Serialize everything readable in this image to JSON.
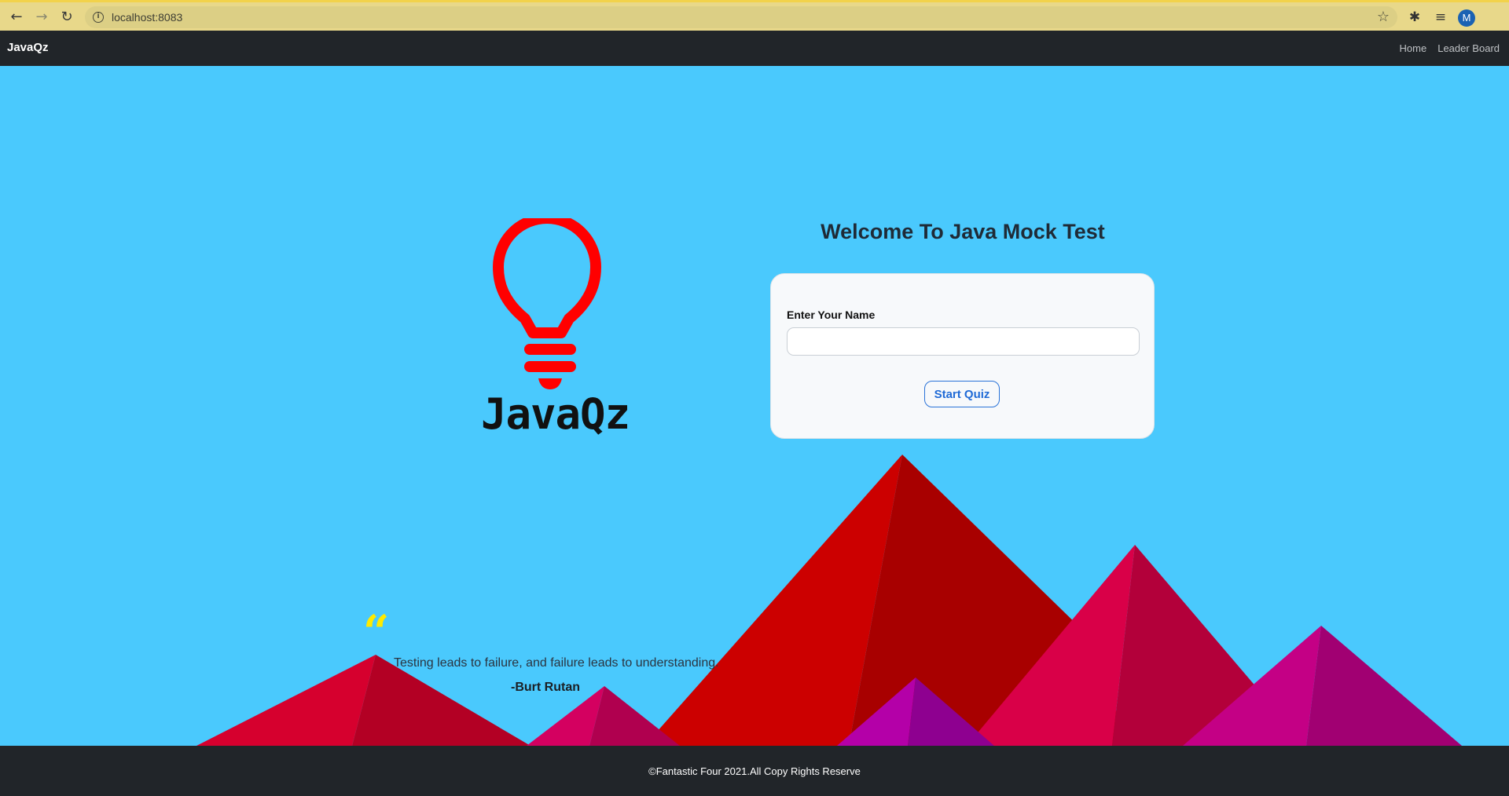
{
  "browser": {
    "url": "localhost:8083",
    "profile_initial": "M",
    "icons": [
      "back-arrow-icon",
      "forward-arrow-icon",
      "reload-icon",
      "info-icon",
      "star-icon",
      "extensions-icon",
      "media-icon"
    ]
  },
  "navbar": {
    "brand": "JavaQz",
    "links": [
      "Home",
      "Leader Board"
    ]
  },
  "logo": {
    "text": "JavaQz",
    "color": "#ff0000"
  },
  "main": {
    "welcome": "Welcome To Java Mock Test",
    "form": {
      "label": "Enter Your Name",
      "input_value": "",
      "input_placeholder": "",
      "button_label": "Start Quiz"
    }
  },
  "quote": {
    "text": "Testing leads to failure, and failure leads to understanding.",
    "author": "-Burt Rutan",
    "mark": "“"
  },
  "footer": {
    "copyright": "©Fantastic Four 2021.All Copy Rights Reserve"
  },
  "colors": {
    "background": "#4ac9fd",
    "navbar": "#212529",
    "accent": "#1f6ad6",
    "quote_mark": "#ffea00"
  }
}
